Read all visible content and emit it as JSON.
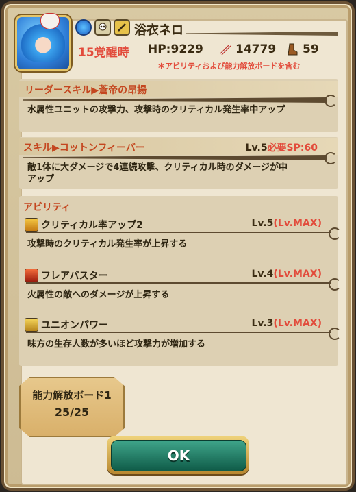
{
  "unit": {
    "name": "浴衣ネロ",
    "awakening": "15覚醒時",
    "hp_label": "HP:9229",
    "atk": "14779",
    "speed": "59",
    "note": "＊アビリティおよび能力解放ボードを含む",
    "icons": [
      "water-element-icon",
      "skull-race-icon",
      "sword-type-icon",
      "sword-icon",
      "boot-icon"
    ]
  },
  "leader": {
    "title": "リーダースキル▶蒼帝の昂揚",
    "desc": "水属性ユニットの攻撃力、攻撃時のクリティカル発生率中アップ"
  },
  "skill": {
    "title": "スキル▶コットンフィーバー",
    "level": "Lv.5",
    "sp": "必要SP:60",
    "desc_line1": "敵1体に大ダメージで4連続攻撃、クリティカル時のダメージが中",
    "desc_line2": "アップ"
  },
  "abilities": {
    "header": "アビリティ",
    "items": [
      {
        "name": "クリティカル率アップ2",
        "level": "Lv.5",
        "max": "(Lv.MAX)",
        "desc": "攻撃時のクリティカル発生率が上昇する"
      },
      {
        "name": "フレアバスター",
        "level": "Lv.4",
        "max": "(Lv.MAX)",
        "desc": "火属性の敵へのダメージが上昇する"
      },
      {
        "name": "ユニオンパワー",
        "level": "Lv.3",
        "max": "(Lv.MAX)",
        "desc": "味方の生存人数が多いほど攻撃力が増加する"
      }
    ]
  },
  "board": {
    "label": "能力解放ボード1",
    "progress": "25/25"
  },
  "ok_label": "OK"
}
